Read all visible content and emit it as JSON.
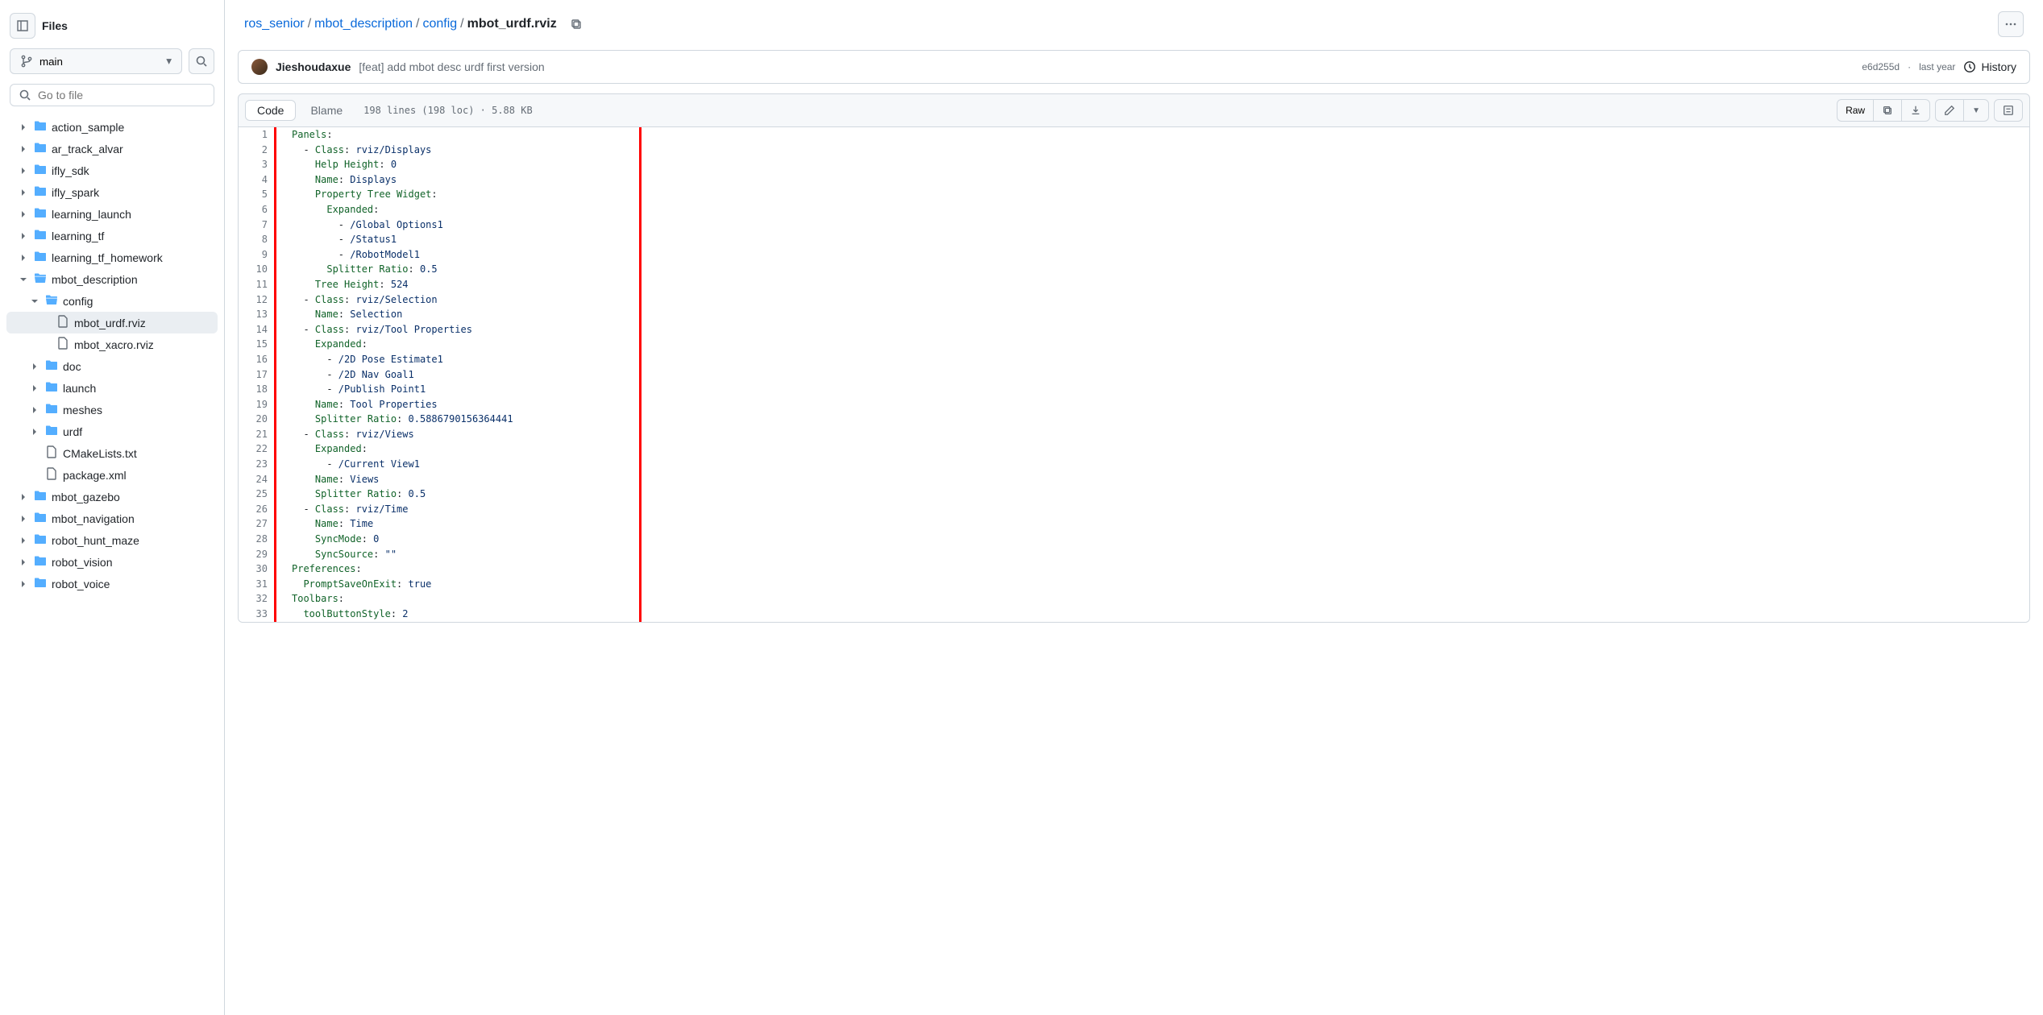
{
  "sidebar": {
    "title": "Files",
    "branch": "main",
    "search_placeholder": "Go to file",
    "tree": [
      {
        "type": "folder",
        "label": "action_sample",
        "depth": 0,
        "open": false
      },
      {
        "type": "folder",
        "label": "ar_track_alvar",
        "depth": 0,
        "open": false
      },
      {
        "type": "folder",
        "label": "ifly_sdk",
        "depth": 0,
        "open": false
      },
      {
        "type": "folder",
        "label": "ifly_spark",
        "depth": 0,
        "open": false
      },
      {
        "type": "folder",
        "label": "learning_launch",
        "depth": 0,
        "open": false
      },
      {
        "type": "folder",
        "label": "learning_tf",
        "depth": 0,
        "open": false
      },
      {
        "type": "folder",
        "label": "learning_tf_homework",
        "depth": 0,
        "open": false
      },
      {
        "type": "folder",
        "label": "mbot_description",
        "depth": 0,
        "open": true
      },
      {
        "type": "folder",
        "label": "config",
        "depth": 1,
        "open": true
      },
      {
        "type": "file",
        "label": "mbot_urdf.rviz",
        "depth": 2,
        "active": true
      },
      {
        "type": "file",
        "label": "mbot_xacro.rviz",
        "depth": 2
      },
      {
        "type": "folder",
        "label": "doc",
        "depth": 1,
        "open": false
      },
      {
        "type": "folder",
        "label": "launch",
        "depth": 1,
        "open": false
      },
      {
        "type": "folder",
        "label": "meshes",
        "depth": 1,
        "open": false
      },
      {
        "type": "folder",
        "label": "urdf",
        "depth": 1,
        "open": false
      },
      {
        "type": "file",
        "label": "CMakeLists.txt",
        "depth": 1
      },
      {
        "type": "file",
        "label": "package.xml",
        "depth": 1
      },
      {
        "type": "folder",
        "label": "mbot_gazebo",
        "depth": 0,
        "open": false
      },
      {
        "type": "folder",
        "label": "mbot_navigation",
        "depth": 0,
        "open": false
      },
      {
        "type": "folder",
        "label": "robot_hunt_maze",
        "depth": 0,
        "open": false
      },
      {
        "type": "folder",
        "label": "robot_vision",
        "depth": 0,
        "open": false
      },
      {
        "type": "folder",
        "label": "robot_voice",
        "depth": 0,
        "open": false
      }
    ]
  },
  "breadcrumb": [
    {
      "label": "ros_senior",
      "link": true
    },
    {
      "label": "mbot_description",
      "link": true
    },
    {
      "label": "config",
      "link": true
    },
    {
      "label": "mbot_urdf.rviz",
      "link": false
    }
  ],
  "commit": {
    "author": "Jieshoudaxue",
    "message": "[feat] add mbot desc urdf first version",
    "sha": "e6d255d",
    "date": "last year",
    "history_label": "History"
  },
  "file_toolbar": {
    "code_tab": "Code",
    "blame_tab": "Blame",
    "info": "198 lines (198 loc) · 5.88 KB",
    "raw": "Raw"
  },
  "code": [
    {
      "indent": 0,
      "dash": false,
      "key": "Panels",
      "val": ""
    },
    {
      "indent": 1,
      "dash": true,
      "key": "Class",
      "val": "rviz/Displays"
    },
    {
      "indent": 2,
      "dash": false,
      "key": "Help Height",
      "val": "0"
    },
    {
      "indent": 2,
      "dash": false,
      "key": "Name",
      "val": "Displays"
    },
    {
      "indent": 2,
      "dash": false,
      "key": "Property Tree Widget",
      "val": ""
    },
    {
      "indent": 3,
      "dash": false,
      "key": "Expanded",
      "val": ""
    },
    {
      "indent": 4,
      "dash": true,
      "key": "",
      "val": "/Global Options1"
    },
    {
      "indent": 4,
      "dash": true,
      "key": "",
      "val": "/Status1"
    },
    {
      "indent": 4,
      "dash": true,
      "key": "",
      "val": "/RobotModel1"
    },
    {
      "indent": 3,
      "dash": false,
      "key": "Splitter Ratio",
      "val": "0.5"
    },
    {
      "indent": 2,
      "dash": false,
      "key": "Tree Height",
      "val": "524"
    },
    {
      "indent": 1,
      "dash": true,
      "key": "Class",
      "val": "rviz/Selection"
    },
    {
      "indent": 2,
      "dash": false,
      "key": "Name",
      "val": "Selection"
    },
    {
      "indent": 1,
      "dash": true,
      "key": "Class",
      "val": "rviz/Tool Properties"
    },
    {
      "indent": 2,
      "dash": false,
      "key": "Expanded",
      "val": ""
    },
    {
      "indent": 3,
      "dash": true,
      "key": "",
      "val": "/2D Pose Estimate1"
    },
    {
      "indent": 3,
      "dash": true,
      "key": "",
      "val": "/2D Nav Goal1"
    },
    {
      "indent": 3,
      "dash": true,
      "key": "",
      "val": "/Publish Point1"
    },
    {
      "indent": 2,
      "dash": false,
      "key": "Name",
      "val": "Tool Properties"
    },
    {
      "indent": 2,
      "dash": false,
      "key": "Splitter Ratio",
      "val": "0.5886790156364441"
    },
    {
      "indent": 1,
      "dash": true,
      "key": "Class",
      "val": "rviz/Views"
    },
    {
      "indent": 2,
      "dash": false,
      "key": "Expanded",
      "val": ""
    },
    {
      "indent": 3,
      "dash": true,
      "key": "",
      "val": "/Current View1"
    },
    {
      "indent": 2,
      "dash": false,
      "key": "Name",
      "val": "Views"
    },
    {
      "indent": 2,
      "dash": false,
      "key": "Splitter Ratio",
      "val": "0.5"
    },
    {
      "indent": 1,
      "dash": true,
      "key": "Class",
      "val": "rviz/Time"
    },
    {
      "indent": 2,
      "dash": false,
      "key": "Name",
      "val": "Time"
    },
    {
      "indent": 2,
      "dash": false,
      "key": "SyncMode",
      "val": "0"
    },
    {
      "indent": 2,
      "dash": false,
      "key": "SyncSource",
      "val": "\"\""
    },
    {
      "indent": 0,
      "dash": false,
      "key": "Preferences",
      "val": ""
    },
    {
      "indent": 1,
      "dash": false,
      "key": "PromptSaveOnExit",
      "val": "true"
    },
    {
      "indent": 0,
      "dash": false,
      "key": "Toolbars",
      "val": ""
    },
    {
      "indent": 1,
      "dash": false,
      "key": "toolButtonStyle",
      "val": "2"
    }
  ]
}
